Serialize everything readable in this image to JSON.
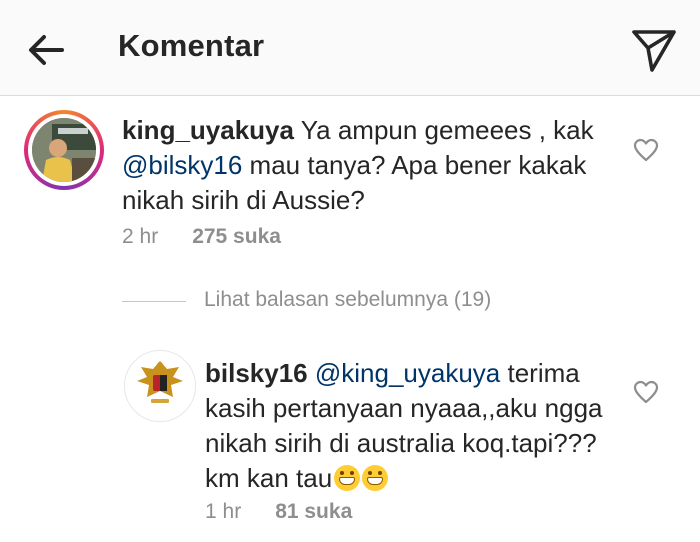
{
  "header": {
    "title": "Komentar",
    "back_icon": "arrow-left-icon",
    "send_icon": "paper-plane-icon"
  },
  "comments": [
    {
      "username": "king_uyakuya",
      "text_before": " Ya ampun gemeees , kak ",
      "mention": "@bilsky16",
      "text_after": " mau tanya? Apa bener kakak nikah sirih di Aussie?",
      "time": "2 hr",
      "likes": "275 suka"
    }
  ],
  "previous_replies": "Lihat balasan sebelumnya (19)",
  "reply": {
    "username": "bilsky16",
    "mention": "@king_uyakuya",
    "text": " terima kasih pertanyaan nyaaa,,aku ngga nikah sirih di australia koq.tapi???km kan tau",
    "emoji": "grinning-face",
    "time": "1 hr",
    "likes": "81 suka"
  },
  "colors": {
    "mention": "#003569",
    "meta": "#8e8e8e",
    "ring_start": "#f58529",
    "ring_end": "#8134af"
  }
}
